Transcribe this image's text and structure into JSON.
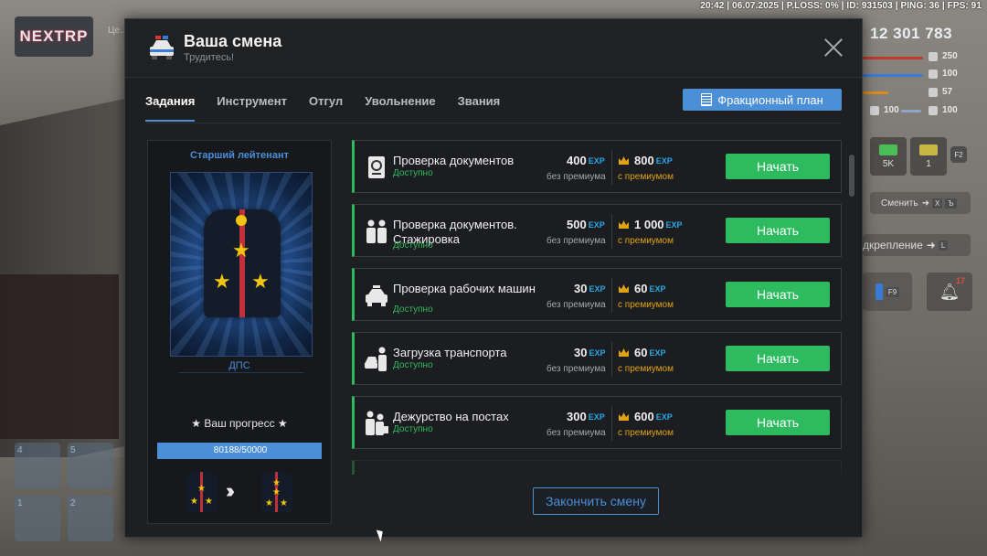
{
  "hud": {
    "topbar": "20:42 | 06.07.2025 | P.LOSS: 0% | ID: 931503 | PING: 36 | FPS: 91",
    "logo": "NEXTRP",
    "left_text": "Це… DO",
    "money": "12 301 783",
    "stats": {
      "armor": "250",
      "hunger": "100",
      "thirst": "57",
      "stamina": "100",
      "health": "100",
      "left_bar_value": "100"
    },
    "inventory": {
      "item1": "5K",
      "item2": "1",
      "key": "F2"
    },
    "change_label": "Сменить",
    "change_keys": [
      "X",
      "Ъ"
    ],
    "backup_label": "дкрепление",
    "backup_key": "L",
    "radio_key": "F9",
    "notif_count": "17",
    "slots": [
      "4",
      "5",
      "1",
      "2"
    ]
  },
  "window": {
    "title": "Ваша смена",
    "subtitle": "Трудитесь!",
    "tabs": [
      "Задания",
      "Инструмент",
      "Отгул",
      "Увольнение",
      "Звания"
    ],
    "active_tab": 0,
    "plan_button": "Фракционный план",
    "accent": "#4a8fd8",
    "green": "#2ebb5f"
  },
  "rank": {
    "name": "Старший лейтенант",
    "department": "ДПС",
    "progress_label": "★ Ваш прогресс ★",
    "progress_text": "80188/50000",
    "progress_fraction": 1.0
  },
  "tasks": [
    {
      "name": "Проверка документов",
      "status": "Доступно",
      "exp": "400",
      "exp_premium": "800",
      "icon": "passport-icon"
    },
    {
      "name": "Проверка документов. Стажировка",
      "status": "Доступно",
      "exp": "500",
      "exp_premium": "1 000",
      "icon": "officers-icon"
    },
    {
      "name": "Проверка рабочих машин",
      "status": "Доступно",
      "exp": "30",
      "exp_premium": "60",
      "icon": "police-car-icon"
    },
    {
      "name": "Загрузка транспорта",
      "status": "Доступно",
      "exp": "30",
      "exp_premium": "60",
      "icon": "officer-car-icon"
    },
    {
      "name": "Дежурство на постах",
      "status": "Доступно",
      "exp": "300",
      "exp_premium": "600",
      "icon": "patrol-post-icon"
    }
  ],
  "labels": {
    "exp_tag": "EXP",
    "no_premium": "без премиума",
    "with_premium": "с премиумом",
    "start": "Начать",
    "finish": "Закончить смену"
  }
}
